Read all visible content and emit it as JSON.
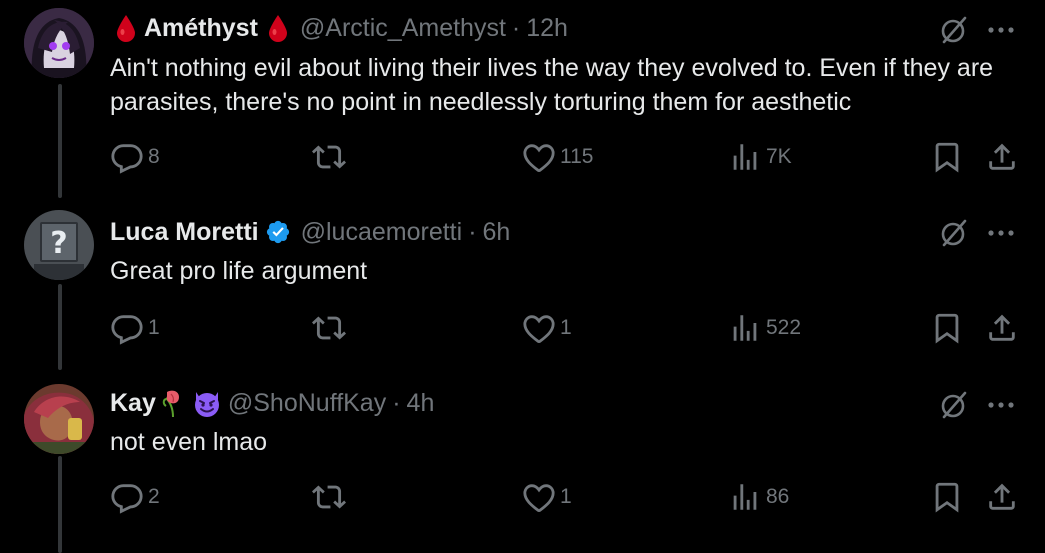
{
  "replies": [
    {
      "display_name": "Améthyst",
      "handle": "@Arctic_Amethyst",
      "separator": "·",
      "time": "12h",
      "text": "Ain't nothing evil about living their lives the way they evolved to. Even if they are parasites, there's no point in needlessly torturing them for aesthetic",
      "stats": {
        "replies": "8",
        "retweets": "",
        "likes": "115",
        "views": "7K"
      }
    },
    {
      "display_name": "Luca Moretti",
      "handle": "@lucaemoretti",
      "separator": "·",
      "time": "6h",
      "text": "Great pro life argument",
      "verified": true,
      "stats": {
        "replies": "1",
        "retweets": "",
        "likes": "1",
        "views": "522"
      }
    },
    {
      "display_name": "Kay",
      "handle": "@ShoNuffKay",
      "separator": "·",
      "time": "4h",
      "text": "not even lmao",
      "stats": {
        "replies": "2",
        "retweets": "",
        "likes": "1",
        "views": "86"
      }
    }
  ],
  "icons": {
    "reply": "reply-icon",
    "retweet": "retweet-icon",
    "like": "heart-icon",
    "views": "views-icon",
    "bookmark": "bookmark-icon",
    "share": "share-icon",
    "grok": "grok-icon",
    "more": "more-icon",
    "verified": "verified-badge-icon",
    "name_emoji_1": "drop-of-blood-emoji",
    "name_emoji_2": "wilted-flower-emoji",
    "name_emoji_3": "smiling-devil-emoji"
  },
  "colors": {
    "background": "#000000",
    "text_primary": "#e7e9ea",
    "text_secondary": "#71767b",
    "thread_line": "#333639",
    "verified_blue": "#1d9bf0",
    "blood_red": "#d0021b",
    "devil_purple": "#8b5cf6"
  }
}
